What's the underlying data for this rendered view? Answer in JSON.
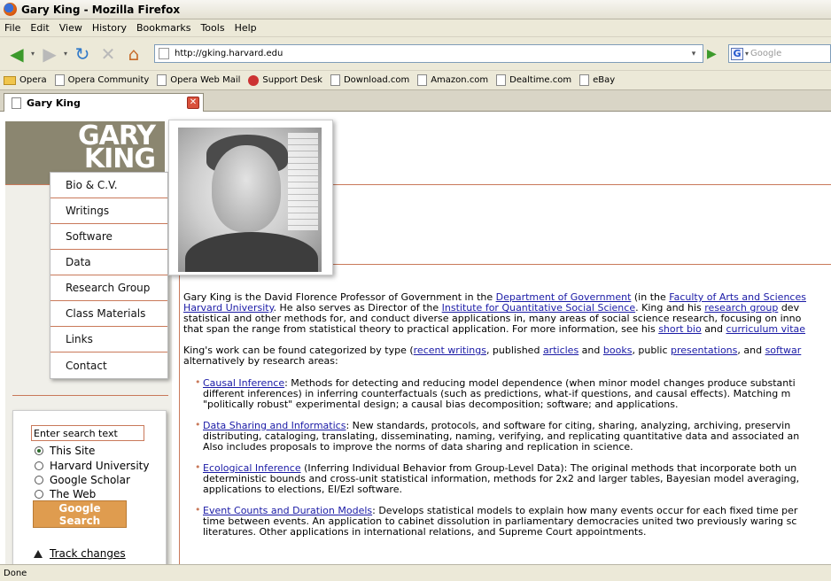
{
  "window": {
    "title": "Gary King - Mozilla Firefox"
  },
  "menu": [
    "File",
    "Edit",
    "View",
    "History",
    "Bookmarks",
    "Tools",
    "Help"
  ],
  "nav": {
    "url": "http://gking.harvard.edu",
    "search_placeholder": "Google"
  },
  "bookmarks": [
    "Opera",
    "Opera Community",
    "Opera Web Mail",
    "Support Desk",
    "Download.com",
    "Amazon.com",
    "Dealtime.com",
    "eBay"
  ],
  "tab": {
    "label": "Gary King"
  },
  "site": {
    "logo_line1": "GARY",
    "logo_line2": "KING",
    "nav": [
      "Bio & C.V.",
      "Writings",
      "Software",
      "Data",
      "Research Group",
      "Class Materials",
      "Links",
      "Contact"
    ],
    "search": {
      "placeholder": "Enter search text",
      "options": [
        "This Site",
        "Harvard University",
        "Google Scholar",
        "The Web"
      ],
      "selected": "This Site",
      "button_line1": "Google",
      "button_line2": "Search"
    },
    "track_changes": "Track changes"
  },
  "intro": {
    "p1_l1_a": "Gary King is the David Florence Professor of Government in the ",
    "p1_l1_link1": "Department of Government",
    "p1_l1_b": " (in the ",
    "p1_l1_link2": "Faculty of Arts and Sciences",
    "p1_l2_link": "Harvard University",
    "p1_l2_a": ". He also serves as Director of the ",
    "p1_l2_link2": "Institute for Quantitative Social Science",
    "p1_l2_b": ". King and his ",
    "p1_l2_link3": "research group",
    "p1_l2_c": " dev",
    "p1_l3": "statistical and other methods for, and conduct diverse applications in, many areas of social science research, focusing on inno",
    "p1_l4_a": "that span the range from statistical theory to practical application. For more information, see his ",
    "p1_l4_link1": "short bio",
    "p1_l4_b": " and ",
    "p1_l4_link2": "curriculum vitae",
    "p2_l1_a": "King's work can be found categorized by type (",
    "p2_l1_link1": "recent writings",
    "p2_l1_b": ", published ",
    "p2_l1_link2": "articles",
    "p2_l1_c": " and ",
    "p2_l1_link3": "books",
    "p2_l1_d": ", public ",
    "p2_l1_link4": "presentations",
    "p2_l1_e": ", and ",
    "p2_l1_link5": "softwar",
    "p2_l2": "alternatively by research areas:"
  },
  "areas": [
    {
      "title": "Causal Inference",
      "l1": ": Methods for detecting and reducing model dependence (when minor model changes produce substanti",
      "l2": "different inferences) in inferring counterfactuals (such as predictions, what-if questions, and causal effects). Matching m",
      "l3": "\"politically robust\" experimental design; a causal bias decomposition; software; and applications."
    },
    {
      "title": "Data Sharing and Informatics",
      "l1": ": New standards, protocols, and software for citing, sharing, analyzing, archiving, preservin",
      "l2": "distributing, cataloging, translating, disseminating, naming, verifying, and replicating quantitative data and associated an",
      "l3": "Also includes proposals to improve the norms of data sharing and replication in science."
    },
    {
      "title": "Ecological Inference",
      "l1": " (Inferring Individual Behavior from Group-Level Data): The original methods that incorporate both un",
      "l2": "deterministic bounds and cross-unit statistical information, methods for 2x2 and larger tables, Bayesian model averaging,",
      "l3": "applications to elections, EI/EzI software."
    },
    {
      "title": "Event Counts and Duration Models",
      "l1": ": Develops statistical models to explain how many events occur for each fixed time per",
      "l2": "time between events. An application to cabinet dissolution in parliamentary democracies united two previously waring sc",
      "l3": "literatures. Other applications in international relations, and Supreme Court appointments."
    }
  ],
  "status": "Done"
}
